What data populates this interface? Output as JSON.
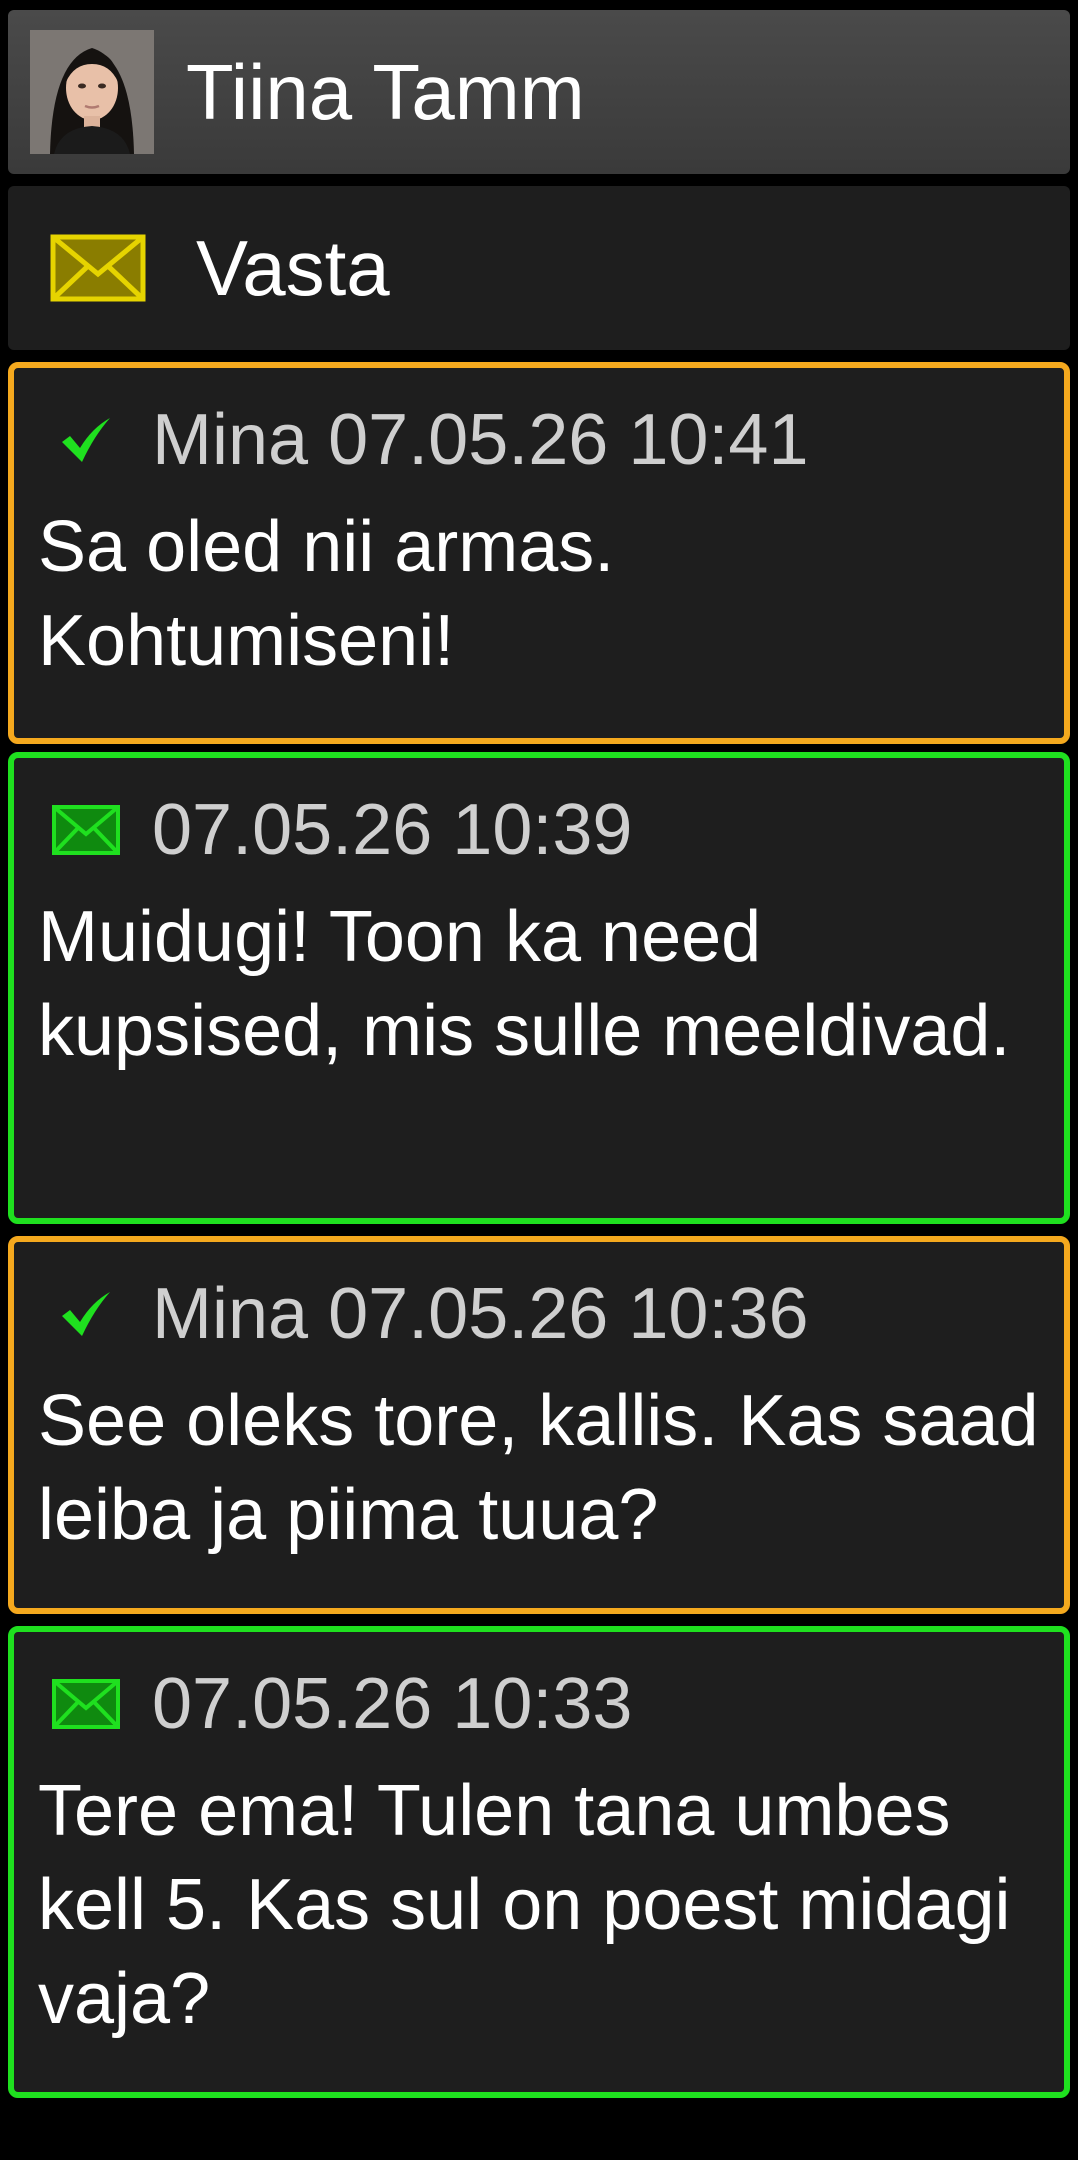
{
  "contact": {
    "name": "Tiina Tamm",
    "avatar_icon": "contact-photo"
  },
  "reply": {
    "label": "Vasta",
    "icon": "envelope-icon",
    "icon_color": "#e6d400"
  },
  "colors": {
    "sent_border": "#f5a91e",
    "received_border": "#1fe01f",
    "card_background": "#1e1e1e",
    "header_background": "#444444",
    "meta_text": "#cfcfcf",
    "body_text": "#ffffff"
  },
  "messages": [
    {
      "direction": "sent",
      "icon": "checkmark-icon",
      "meta": "Mina 07.05.26 10:41",
      "text": "Sa oled nii armas. Kohtumiseni!"
    },
    {
      "direction": "received",
      "icon": "envelope-icon",
      "meta": "07.05.26 10:39",
      "text": "Muidugi! Toon ka need kupsised, mis sulle meeldivad."
    },
    {
      "direction": "sent",
      "icon": "checkmark-icon",
      "meta": "Mina 07.05.26 10:36",
      "text": "See oleks tore, kallis. Kas saad leiba ja piima tuua?"
    },
    {
      "direction": "received",
      "icon": "envelope-icon",
      "meta": "07.05.26 10:33",
      "text": "Tere ema! Tulen tana umbes kell 5. Kas sul on poest midagi vaja?"
    }
  ]
}
